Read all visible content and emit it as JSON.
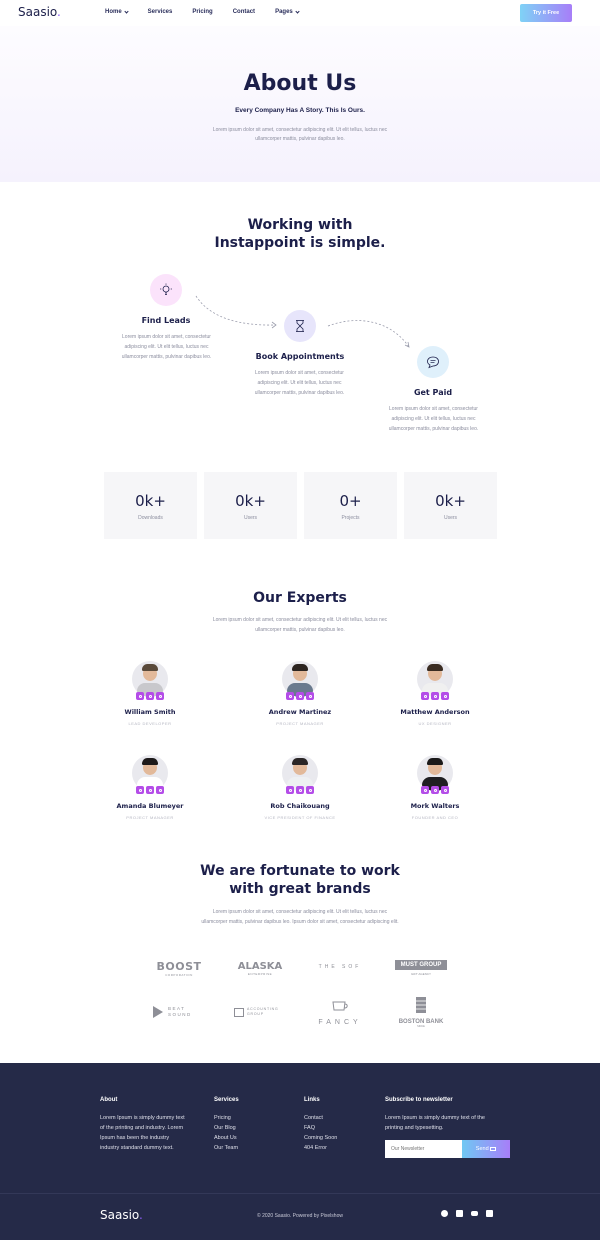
{
  "header": {
    "logo": "Saasio",
    "logo_dot": ".",
    "nav": [
      "Home",
      "Services",
      "Pricing",
      "Contact",
      "Pages"
    ],
    "cta": "Try it Free"
  },
  "hero": {
    "title": "About Us",
    "subtitle": "Every Company Has A Story. This Is Ours.",
    "description": "Lorem ipsum dolor sit amet, consectetur adipiscing elit. Ut elit tellus, luctus nec ullamcorper mattis, pulvinar dapibus leo."
  },
  "working": {
    "title": "Working with Instappoint is simple.",
    "steps": [
      {
        "title": "Find Leads",
        "icon": "lightbulb-icon",
        "desc": "Lorem ipsum dolor sit amet, consectetur adipiscing elit. Ut elit tellus, luctus nec ullamcorper mattis, pulvinar dapibus leo."
      },
      {
        "title": "Book Appointments",
        "icon": "hourglass-icon",
        "desc": "Lorem ipsum dolor sit amet, consectetur adipiscing elit. Ut elit tellus, luctus nec ullamcorper mattis, pulvinar dapibus leo."
      },
      {
        "title": "Get Paid",
        "icon": "chat-bubble-icon",
        "desc": "Lorem ipsum dolor sit amet, consectetur adipiscing elit. Ut elit tellus, luctus nec ullamcorper mattis, pulvinar dapibus leo."
      }
    ],
    "circle_colors": [
      "#fbe3fb",
      "#e7e5fb",
      "#dff0fb"
    ]
  },
  "stats": [
    {
      "value": "0k+",
      "label": "Downloads"
    },
    {
      "value": "0k+",
      "label": "Users"
    },
    {
      "value": "0+",
      "label": "Projects"
    },
    {
      "value": "0k+",
      "label": "Users"
    }
  ],
  "experts": {
    "title": "Our Experts",
    "description": "Lorem ipsum dolor sit amet, consectetur adipiscing elit. Ut elit tellus, luctus nec ullamcorper mattis, pulvinar dapibus leo.",
    "members": [
      {
        "name": "William Smith",
        "role": "LEAD DEVELOPER"
      },
      {
        "name": "Andrew Martinez",
        "role": "PROJECT MANAGER"
      },
      {
        "name": "Matthew Anderson",
        "role": "UX DESIGNER"
      },
      {
        "name": "Amanda Blumeyer",
        "role": "PROJECT MANAGER"
      },
      {
        "name": "Rob Chaikouang",
        "role": "VICE PRESIDENT OF FINANCE"
      },
      {
        "name": "Mork Walters",
        "role": "FOUNDER AND CEO"
      }
    ],
    "social_icons": [
      "dribbble-icon",
      "twitter-icon",
      "youtube-icon"
    ]
  },
  "brands": {
    "title": "We are fortunate to work with great brands",
    "description": "Lorem ipsum dolor sit amet, consectetur adipiscing elit. Ut elit tellus, luctus nec ullamcorper mattis, pulvinar dapibus leo. Ipsum dolor sit amet, consectetur adipiscing elit.",
    "logos": [
      {
        "main": "BOOST",
        "sub": "CORPORATION"
      },
      {
        "main": "ALASKA",
        "sub": "ENTERPRISE"
      },
      {
        "main": "THE SOF",
        "sub": ""
      },
      {
        "main": "MUST GROUP",
        "sub": "GIFT AGENCY"
      },
      {
        "main": "BEAT SOUND",
        "sub": ""
      },
      {
        "main": "ACCOUNTING GROUP",
        "sub": ""
      },
      {
        "main": "FANCY",
        "sub": ""
      },
      {
        "main": "BOSTON BANK",
        "sub": "SINCE"
      }
    ]
  },
  "footer": {
    "about_heading": "About",
    "about_text": "Lorem Ipsum is simply dummy text of the printing and industry. Lorem Ipsum has been the industry industry standard dummy text.",
    "services_heading": "Services",
    "services": [
      "Pricing",
      "Our Blog",
      "About Us",
      "Our Team"
    ],
    "links_heading": "Links",
    "links": [
      "Contact",
      "FAQ",
      "Coming Soon",
      "404 Error"
    ],
    "newsletter_heading": "Subscribe to newsletter",
    "newsletter_text": "Lorem Ipsum is simply dummy text of the printing and typesetting.",
    "newsletter_placeholder": "Our Newsletter",
    "send_label": "Send",
    "logo": "Saasio",
    "logo_dot": ".",
    "copyright": "© 2020 Saasio. Powered by Pixelshow",
    "social_icons": [
      "dribbble-icon",
      "twitter-icon",
      "youtube-icon",
      "linkedin-icon"
    ]
  }
}
